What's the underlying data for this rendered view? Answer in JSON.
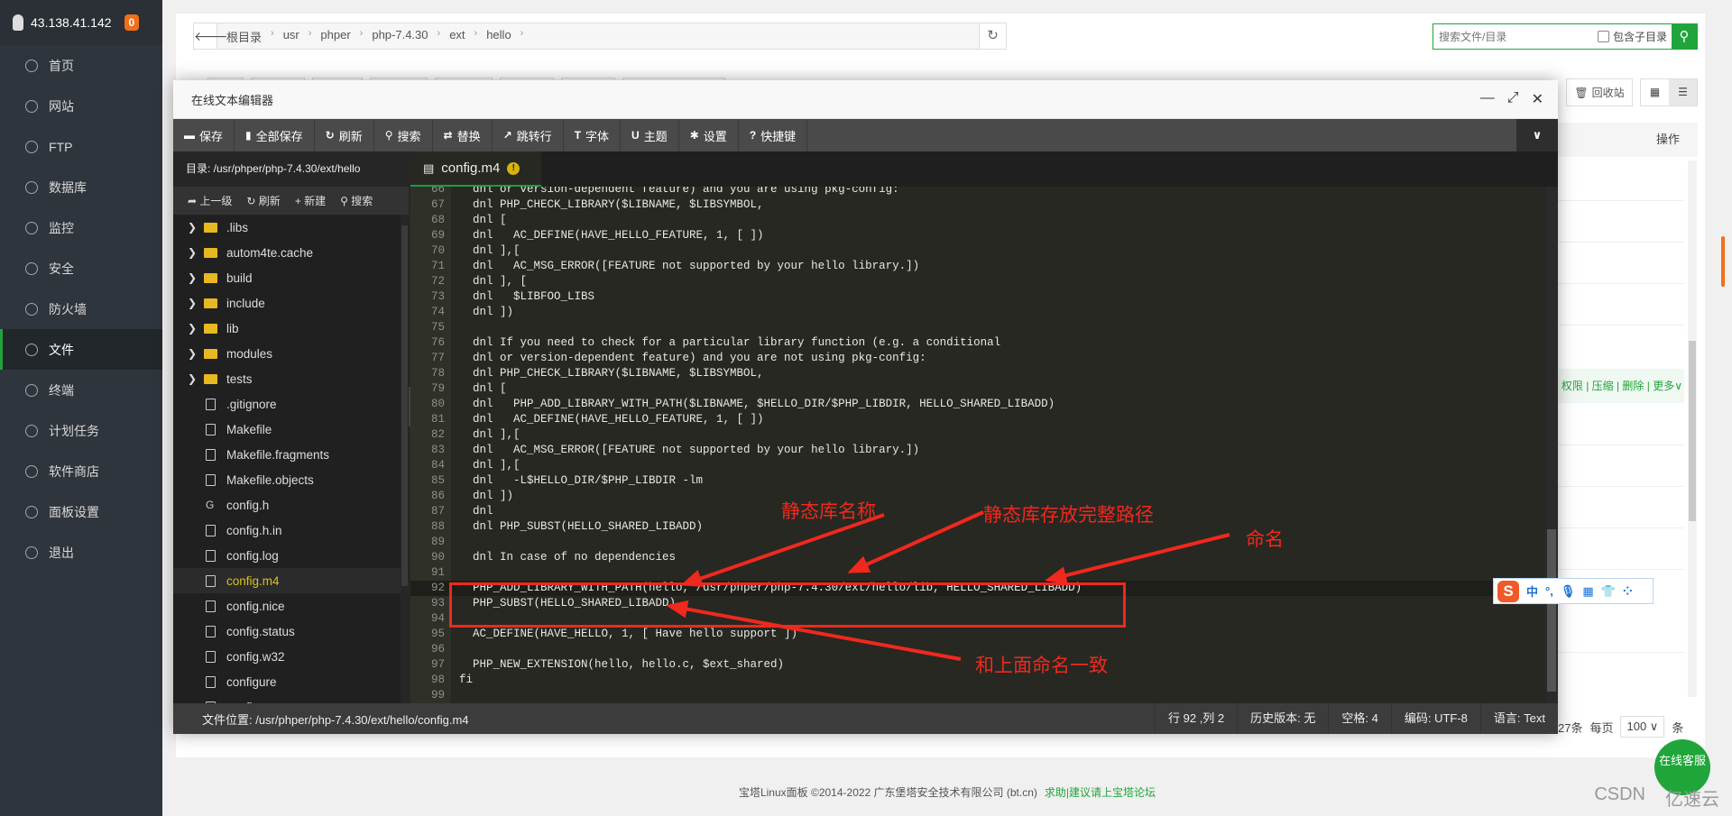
{
  "sidebar": {
    "server_ip": "43.138.41.142",
    "notice_count": "0",
    "items": [
      {
        "label": "首页",
        "icon": "home-icon"
      },
      {
        "label": "网站",
        "icon": "globe-icon"
      },
      {
        "label": "FTP",
        "icon": "ftp-icon"
      },
      {
        "label": "数据库",
        "icon": "database-icon"
      },
      {
        "label": "监控",
        "icon": "monitor-icon"
      },
      {
        "label": "安全",
        "icon": "shield-icon"
      },
      {
        "label": "防火墙",
        "icon": "firewall-icon"
      },
      {
        "label": "文件",
        "icon": "folder-icon",
        "active": true
      },
      {
        "label": "终端",
        "icon": "terminal-icon"
      },
      {
        "label": "计划任务",
        "icon": "calendar-icon"
      },
      {
        "label": "软件商店",
        "icon": "store-icon"
      },
      {
        "label": "面板设置",
        "icon": "gear-icon"
      },
      {
        "label": "退出",
        "icon": "logout-icon"
      }
    ]
  },
  "breadcrumb": [
    "根目录",
    "usr",
    "phper",
    "php-7.4.30",
    "ext",
    "hello"
  ],
  "search": {
    "placeholder": "搜索文件/目录",
    "include_subdir_label": "包含子目录"
  },
  "recycle_label": "回收站",
  "table": {
    "ops_header": "操作",
    "row_actions": "权限 | 压缩 | 删除 | 更多∨"
  },
  "pager": {
    "total": "27条",
    "per_page_label": "每页",
    "per_page": "100",
    "unit": "条"
  },
  "footer": {
    "copyright": "宝塔Linux面板 ©2014-2022 广东堡塔安全技术有限公司 (bt.cn)",
    "link": "求助|建议请上宝塔论坛"
  },
  "chat_label": "在线客服",
  "watermarks": [
    "CSDN",
    "亿速云"
  ],
  "editor": {
    "title": "在线文本编辑器",
    "toolbar": [
      {
        "label": "保存",
        "icon": "save-icon"
      },
      {
        "label": "全部保存",
        "icon": "save-all-icon"
      },
      {
        "label": "刷新",
        "icon": "refresh-icon"
      },
      {
        "label": "搜索",
        "icon": "search-icon"
      },
      {
        "label": "替换",
        "icon": "replace-icon"
      },
      {
        "label": "跳转行",
        "icon": "goto-line-icon"
      },
      {
        "label": "字体",
        "icon": "font-icon"
      },
      {
        "label": "主题",
        "icon": "theme-icon"
      },
      {
        "label": "设置",
        "icon": "gear-icon"
      },
      {
        "label": "快捷键",
        "icon": "help-icon"
      }
    ],
    "directory": "目录: /usr/phper/php-7.4.30/ext/hello",
    "file_actions": [
      "上一级",
      "刷新",
      "新建",
      "搜索"
    ],
    "files": [
      {
        "name": ".libs",
        "type": "folder"
      },
      {
        "name": "autom4te.cache",
        "type": "folder"
      },
      {
        "name": "build",
        "type": "folder"
      },
      {
        "name": "include",
        "type": "folder"
      },
      {
        "name": "lib",
        "type": "folder"
      },
      {
        "name": "modules",
        "type": "folder"
      },
      {
        "name": "tests",
        "type": "folder"
      },
      {
        "name": ".gitignore",
        "type": "file"
      },
      {
        "name": "Makefile",
        "type": "file"
      },
      {
        "name": "Makefile.fragments",
        "type": "file"
      },
      {
        "name": "Makefile.objects",
        "type": "file"
      },
      {
        "name": "config.h",
        "type": "cfile"
      },
      {
        "name": "config.h.in",
        "type": "file"
      },
      {
        "name": "config.log",
        "type": "file"
      },
      {
        "name": "config.m4",
        "type": "file",
        "selected": true
      },
      {
        "name": "config.nice",
        "type": "file"
      },
      {
        "name": "config.status",
        "type": "file"
      },
      {
        "name": "config.w32",
        "type": "file"
      },
      {
        "name": "configure",
        "type": "file"
      },
      {
        "name": "configure.ac",
        "type": "file"
      }
    ],
    "tab": "config.m4",
    "current_line": 92,
    "code": [
      {
        "n": 66,
        "t": "  dnl or version-dependent feature) and you are using pkg-config:"
      },
      {
        "n": 67,
        "t": "  dnl PHP_CHECK_LIBRARY($LIBNAME, $LIBSYMBOL,"
      },
      {
        "n": 68,
        "t": "  dnl ["
      },
      {
        "n": 69,
        "t": "  dnl   AC_DEFINE(HAVE_HELLO_FEATURE, 1, [ ])"
      },
      {
        "n": 70,
        "t": "  dnl ],["
      },
      {
        "n": 71,
        "t": "  dnl   AC_MSG_ERROR([FEATURE not supported by your hello library.])"
      },
      {
        "n": 72,
        "t": "  dnl ], ["
      },
      {
        "n": 73,
        "t": "  dnl   $LIBFOO_LIBS"
      },
      {
        "n": 74,
        "t": "  dnl ])"
      },
      {
        "n": 75,
        "t": ""
      },
      {
        "n": 76,
        "t": "  dnl If you need to check for a particular library function (e.g. a conditional"
      },
      {
        "n": 77,
        "t": "  dnl or version-dependent feature) and you are not using pkg-config:"
      },
      {
        "n": 78,
        "t": "  dnl PHP_CHECK_LIBRARY($LIBNAME, $LIBSYMBOL,"
      },
      {
        "n": 79,
        "t": "  dnl ["
      },
      {
        "n": 80,
        "t": "  dnl   PHP_ADD_LIBRARY_WITH_PATH($LIBNAME, $HELLO_DIR/$PHP_LIBDIR, HELLO_SHARED_LIBADD)"
      },
      {
        "n": 81,
        "t": "  dnl   AC_DEFINE(HAVE_HELLO_FEATURE, 1, [ ])"
      },
      {
        "n": 82,
        "t": "  dnl ],["
      },
      {
        "n": 83,
        "t": "  dnl   AC_MSG_ERROR([FEATURE not supported by your hello library.])"
      },
      {
        "n": 84,
        "t": "  dnl ],["
      },
      {
        "n": 85,
        "t": "  dnl   -L$HELLO_DIR/$PHP_LIBDIR -lm"
      },
      {
        "n": 86,
        "t": "  dnl ])"
      },
      {
        "n": 87,
        "t": "  dnl"
      },
      {
        "n": 88,
        "t": "  dnl PHP_SUBST(HELLO_SHARED_LIBADD)"
      },
      {
        "n": 89,
        "t": ""
      },
      {
        "n": 90,
        "t": "  dnl In case of no dependencies"
      },
      {
        "n": 91,
        "t": ""
      },
      {
        "n": 92,
        "t": "  PHP_ADD_LIBRARY_WITH_PATH(hello, /usr/phper/php-7.4.30/ext/hello/lib, HELLO_SHARED_LIBADD)"
      },
      {
        "n": 93,
        "t": "  PHP_SUBST(HELLO_SHARED_LIBADD)"
      },
      {
        "n": 94,
        "t": ""
      },
      {
        "n": 95,
        "t": "  AC_DEFINE(HAVE_HELLO, 1, [ Have hello support ])"
      },
      {
        "n": 96,
        "t": ""
      },
      {
        "n": 97,
        "t": "  PHP_NEW_EXTENSION(hello, hello.c, $ext_shared)"
      },
      {
        "n": 98,
        "t": "fi"
      },
      {
        "n": 99,
        "t": ""
      }
    ],
    "status": {
      "file_path": "文件位置: /usr/phper/php-7.4.30/ext/hello/config.m4",
      "cursor": "行 92 ,列 2",
      "history": "历史版本: 无",
      "indent": "空格: 4",
      "encoding": "编码: UTF-8",
      "language": "语言: Text"
    }
  },
  "annotations": {
    "lib_name": "静态库名称",
    "lib_path": "静态库存放完整路径",
    "naming": "命名",
    "consistent": "和上面命名一致",
    "color": "#f0281e"
  },
  "ime": {
    "lang": "中"
  }
}
